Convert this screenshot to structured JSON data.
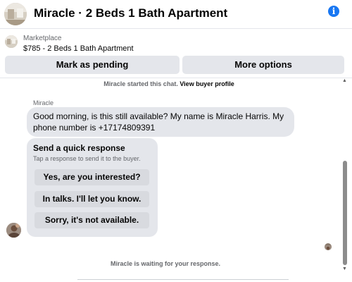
{
  "header": {
    "title": "Miracle · 2 Beds 1 Bath Apartment",
    "info_icon": "info-icon"
  },
  "listing": {
    "label": "Marketplace",
    "title": "$785 - 2 Beds 1 Bath Apartment"
  },
  "actions": {
    "pending_label": "Mark as pending",
    "more_label": "More options"
  },
  "chat": {
    "started_prefix": "Miracle started this chat.",
    "started_link": "View buyer profile",
    "sender_name": "Miracle",
    "message": "Good morning, is this still available? My name is Miracle Harris. My phone number is +17174809391",
    "quick": {
      "title": "Send a quick response",
      "subtitle": "Tap a response to send it to the buyer.",
      "options": [
        "Yes, are you interested?",
        "In talks. I'll let you know.",
        "Sorry, it's not available."
      ]
    },
    "waiting": "Miracle is waiting for your response."
  },
  "colors": {
    "accent": "#1877f2",
    "bubble": "#e4e6eb",
    "secondary_text": "#65676b"
  }
}
